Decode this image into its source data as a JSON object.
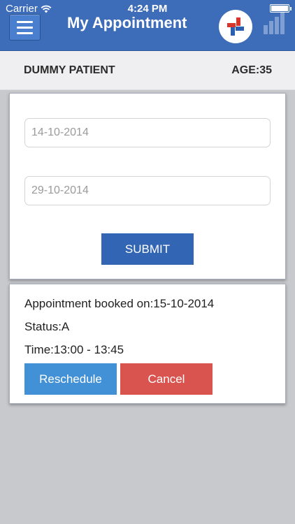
{
  "status_bar": {
    "carrier": "Carrier",
    "time": "4:24 PM",
    "wifi_icon": "wifi-icon",
    "battery_icon": "battery-icon"
  },
  "header": {
    "title": "My Appointment",
    "menu_icon": "hamburger-menu-icon",
    "logo_icon": "app-logo-icon",
    "stats_icon": "bar-chart-icon",
    "color": "#3d6cb8"
  },
  "patient": {
    "name": "DUMMY PATIENT",
    "age": "AGE:35"
  },
  "form": {
    "from_date_placeholder": "14-10-2014",
    "to_date_placeholder": "29-10-2014",
    "submit_label": "SUBMIT"
  },
  "appointment": {
    "booked_on": "Appointment booked on:15-10-2014",
    "status": "Status:A",
    "time": "Time:13:00 - 13:45",
    "reschedule_label": "Reschedule",
    "cancel_label": "Cancel"
  },
  "colors": {
    "submit": "#3265b3",
    "reschedule": "#4290d6",
    "cancel": "#d9534f",
    "background": "#c7c9cd"
  }
}
